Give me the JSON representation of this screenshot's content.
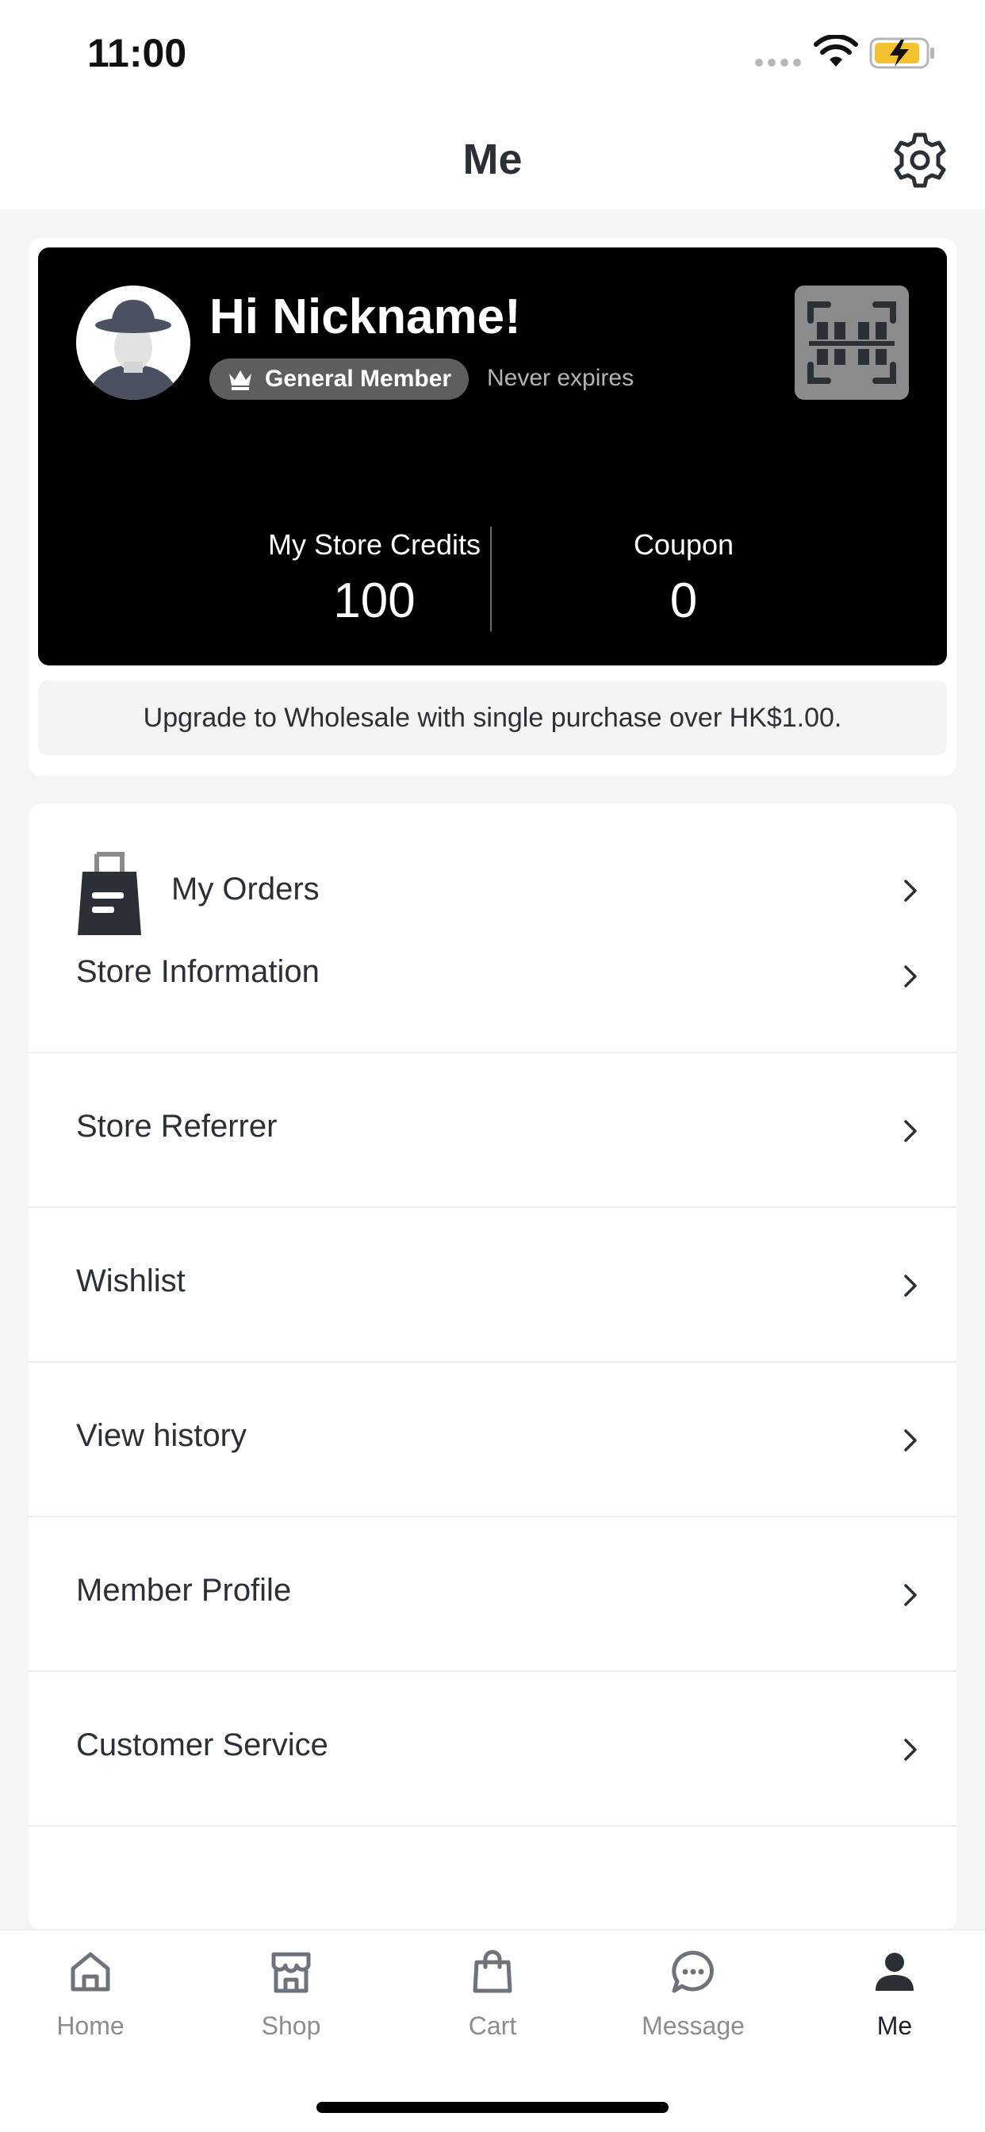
{
  "status_bar": {
    "time": "11:00",
    "icons": [
      "signal-dots-icon",
      "wifi-icon",
      "battery-charging-icon"
    ]
  },
  "header": {
    "title": "Me",
    "settings_icon": "gear-icon"
  },
  "member_card": {
    "greeting": "Hi Nickname!",
    "tier": "General Member",
    "tier_icon": "crown-icon",
    "expiry": "Never expires",
    "qr_icon": "barcode-scan-icon",
    "credits_label": "My Store Credits",
    "credits_value": "100",
    "coupon_label": "Coupon",
    "coupon_value": "0",
    "upgrade_note": "Upgrade to Wholesale with single purchase over HK$1.00."
  },
  "menu": {
    "orders_label": "My Orders",
    "items": [
      {
        "label": "Store Information"
      },
      {
        "label": "Store Referrer"
      },
      {
        "label": "Wishlist"
      },
      {
        "label": "View history"
      },
      {
        "label": "Member Profile"
      },
      {
        "label": "Customer Service"
      }
    ]
  },
  "tab_bar": {
    "items": [
      {
        "label": "Home",
        "icon": "home-icon"
      },
      {
        "label": "Shop",
        "icon": "shop-icon"
      },
      {
        "label": "Cart",
        "icon": "shopping-bag-icon"
      },
      {
        "label": "Message",
        "icon": "chat-bubble-icon"
      },
      {
        "label": "Me",
        "icon": "person-icon",
        "active": true
      }
    ]
  },
  "colors": {
    "card_background": "#000000",
    "page_background": "#f5f5f5",
    "text_primary": "#2b2f36",
    "tab_inactive": "#8a8d93"
  }
}
